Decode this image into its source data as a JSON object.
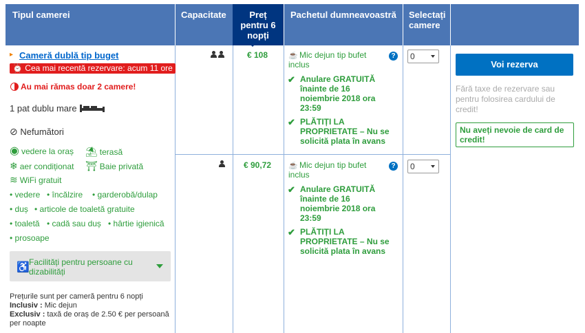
{
  "header": {
    "room_type": "Tipul camerei",
    "capacity": "Capacitate",
    "price_line1": "Preț",
    "price_line2": "pentru 6",
    "price_line3": "nopți",
    "package": "Pachetul dumneavoastră",
    "select_line1": "Selectați",
    "select_line2": "camere"
  },
  "room": {
    "name": "Cameră dublă tip buget",
    "recent_booking": "Cea mai recentă rezervare: acum 11 ore",
    "urgency": "Au mai rămas doar 2 camere!",
    "bed": "1 pat dublu mare",
    "smoking": "Nefumători",
    "facilities_icons": [
      {
        "icon": "eye-icon",
        "label": "vedere la oraș"
      },
      {
        "icon": "terrace-icon",
        "label": "terasă"
      },
      {
        "icon": "snowflake-icon",
        "label": "aer condiționat"
      },
      {
        "icon": "shower-icon",
        "label": "Baie privată"
      },
      {
        "icon": "wifi-icon",
        "label": "WiFi gratuit"
      }
    ],
    "amenities": [
      "vedere",
      "încălzire",
      "garderobă/dulap",
      "duș",
      "articole de toaletă gratuite",
      "toaletă",
      "cadă sau duș",
      "hârtie igienică",
      "prosoape"
    ],
    "accessibility": "Facilități pentru persoane cu dizabilități",
    "note_line1": "Prețurile sunt per cameră pentru 6 nopți",
    "note_inclusiv_label": "Inclusiv :",
    "note_inclusiv_value": " Mic dejun",
    "note_exclusiv_label": "Exclusiv :",
    "note_exclusiv_value": " taxă de oraș de 2.50 € per persoană per noapte"
  },
  "options": [
    {
      "capacity_icon": "two-persons-icon",
      "price": "€ 108",
      "meal": "Mic dejun tip bufet inclus",
      "cancel": "Anulare GRATUITĂ înainte de 16 noiembrie 2018 ora 23:59",
      "pay": "PLĂTIȚI LA PROPRIETATE – Nu se solicită plata în avans",
      "select_value": "0"
    },
    {
      "capacity_icon": "one-person-icon",
      "price": "€ 90,72",
      "meal": "Mic dejun tip bufet inclus",
      "cancel": "Anulare GRATUITĂ înainte de 16 noiembrie 2018 ora 23:59",
      "pay": "PLĂTIȚI LA PROPRIETATE – Nu se solicită plata în avans",
      "select_value": "0"
    }
  ],
  "sidebar": {
    "reserve": "Voi rezerva",
    "fees": "Fără taxe de rezervare sau pentru folosirea cardului de credit!",
    "no_card": "Nu aveți nevoie de card de credit!"
  },
  "colors": {
    "header": "#4b76b5",
    "header_active": "#003580",
    "green": "#2e9d3c",
    "red": "#e11d1d",
    "button": "#0071c2"
  }
}
